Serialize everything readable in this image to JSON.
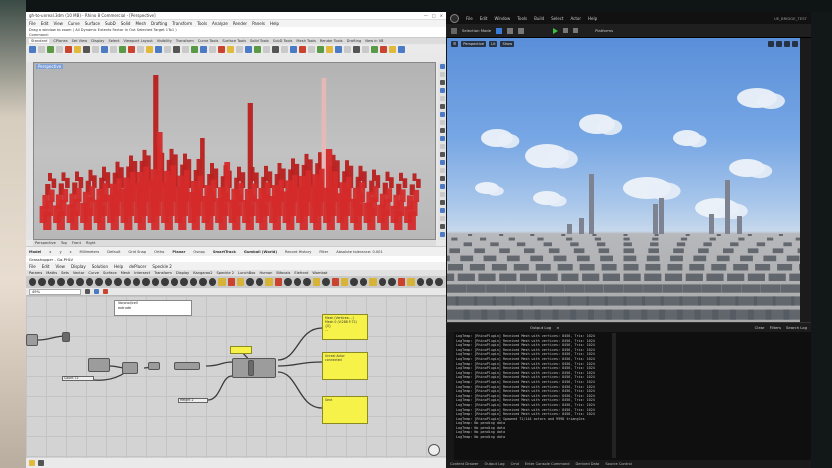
{
  "rhino": {
    "title": "gh-to-unreal.3dm (10 MB) - Rhino 8 Commercial - [Perspective]",
    "menu": [
      "File",
      "Edit",
      "View",
      "Curve",
      "Surface",
      "SubD",
      "Solid",
      "Mesh",
      "Drafting",
      "Transform",
      "Tools",
      "Analyze",
      "Render",
      "Panels",
      "Help"
    ],
    "cmd_lines": [
      "Drag a window to zoom ( All Dynamic Extents Factor In Out Selected Target 1To1 )",
      "Command:"
    ],
    "tabs": [
      "Standard",
      "CPlanes",
      "Set View",
      "Display",
      "Select",
      "Viewport Layout",
      "Visibility",
      "Transform",
      "Curve Tools",
      "Surface Tools",
      "Solid Tools",
      "SubD Tools",
      "Mesh Tools",
      "Render Tools",
      "Drafting",
      "New in V8"
    ],
    "viewport_label": "Perspective",
    "viewport_tabs": [
      "Perspective",
      "Top",
      "Front",
      "Right"
    ],
    "status": [
      {
        "label": "Model",
        "on": true
      },
      {
        "label": "x",
        "on": false
      },
      {
        "label": "y",
        "on": false
      },
      {
        "label": "z",
        "on": false
      },
      {
        "label": "Millimeters",
        "on": false
      },
      {
        "label": "Default",
        "on": false
      },
      {
        "label": "Grid Snap",
        "on": false
      },
      {
        "label": "Ortho",
        "on": false
      },
      {
        "label": "Planar",
        "on": true
      },
      {
        "label": "Osnap",
        "on": false
      },
      {
        "label": "SmartTrack",
        "on": true
      },
      {
        "label": "Gumball (World)",
        "on": true
      },
      {
        "label": "Record History",
        "on": false
      },
      {
        "label": "Filter",
        "on": false
      },
      {
        "label": "Absolute tolerance: 0.001",
        "on": false
      }
    ]
  },
  "grasshopper": {
    "title": "Grasshopper - Ga-PHLV",
    "menu": [
      "File",
      "Edit",
      "View",
      "Display",
      "Solution",
      "Help",
      "dePlacer",
      "Speckle 2"
    ],
    "tabs": [
      "Params",
      "Maths",
      "Sets",
      "Vector",
      "Curve",
      "Surface",
      "Mesh",
      "Intersect",
      "Transform",
      "Display",
      "Kangaroo2",
      "Speckle 2",
      "LunchBox",
      "Human",
      "Bifocals",
      "Elefront",
      "Wombat"
    ],
    "zoom": "49%",
    "popup_items": [
      "Voronoi/cell",
      "extrude"
    ],
    "sliders": [
      "Count 72",
      "Height 2"
    ],
    "panels": [
      [
        "Mesh (Vertices:...)",
        "Mesh 0 (V:288 F:72)",
        "{0}",
        "..."
      ],
      [
        "Unreal Actor",
        "connected"
      ],
      [
        "Sent"
      ]
    ]
  },
  "unreal": {
    "menu": [
      "File",
      "Edit",
      "Window",
      "Tools",
      "Build",
      "Select",
      "Actor",
      "Help"
    ],
    "project": "UE_BRIDGE_TEST",
    "toolbar": [
      "Selection Mode",
      "Platforms"
    ],
    "viewport_buttons": [
      "Perspective",
      "Lit",
      "Show"
    ],
    "log_title": "Output Log",
    "log_tabs": [
      "Clear",
      "Filters",
      "Search Log"
    ],
    "log_lines": [
      "LogTemp: [RhinoPlugin] Received Mesh with vertices: 8456, Tris: 1024",
      "LogTemp: [RhinoPlugin] Received Mesh with vertices: 8456, Tris: 1024",
      "LogTemp: [RhinoPlugin] Received Mesh with vertices: 8456, Tris: 1024",
      "LogTemp: [RhinoPlugin] Received Mesh with vertices: 8456, Tris: 1024",
      "LogTemp: [RhinoPlugin] Received Mesh with vertices: 8456, Tris: 1024",
      "LogTemp: [RhinoPlugin] Received Mesh with vertices: 8456, Tris: 1024",
      "LogTemp: [RhinoPlugin] Received Mesh with vertices: 8456, Tris: 1024",
      "LogTemp: [RhinoPlugin] Received Mesh with vertices: 8456, Tris: 1024",
      "LogTemp: [RhinoPlugin] Received Mesh with vertices: 8456, Tris: 1024",
      "LogTemp: [RhinoPlugin] Received Mesh with vertices: 8456, Tris: 1024",
      "LogTemp: [RhinoPlugin] Received Mesh with vertices: 8456, Tris: 1024",
      "LogTemp: [RhinoPlugin] Received Mesh with vertices: 8456, Tris: 1024",
      "LogTemp: [RhinoPlugin] Received Mesh with vertices: 8456, Tris: 1024",
      "LogTemp: [RhinoPlugin] Received Mesh with vertices: 8456, Tris: 1024",
      "LogTemp: [RhinoPlugin] Received Mesh with vertices: 8456, Tris: 1024",
      "LogTemp: [RhinoPlugin] Received Mesh with vertices: 8456, Tris: 1024",
      "LogTemp: [RhinoPlugin] Received Mesh with vertices: 8456, Tris: 1024",
      "LogTemp: [RhinoPlugin] Received Mesh with vertices: 8456, Tris: 1024",
      "LogTemp: [RhinoPlugin] Spawned 72/144 actors and 9998 triangles",
      "LogTemp: No pending data",
      "LogTemp: No pending data",
      "LogTemp: No pending data",
      "LogTemp: No pending data"
    ],
    "bottom": [
      "Content Drawer",
      "Output Log",
      "Cmd",
      "Enter Console Command",
      "Derived Data",
      "Source Control"
    ]
  },
  "colors": {
    "rhino_red": "#d42a2a",
    "panel_yellow": "#f6f24a",
    "ue_bg": "#151515"
  }
}
